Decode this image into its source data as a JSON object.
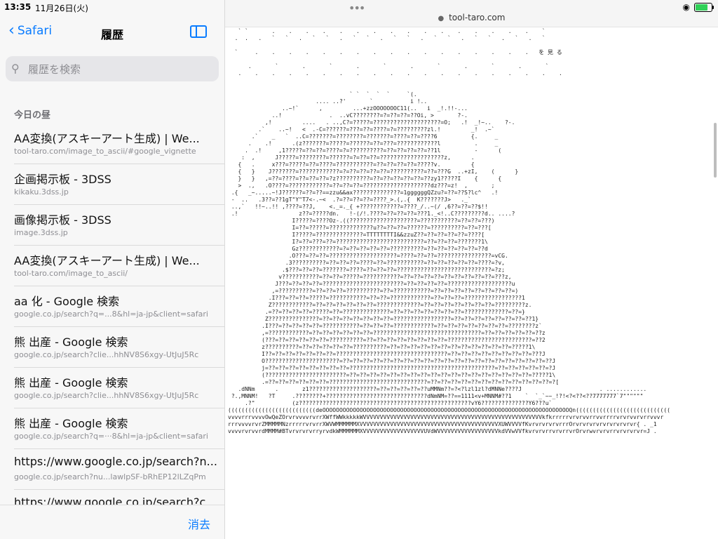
{
  "status": {
    "time": "13:35",
    "date": "11月26日(火)"
  },
  "sidebar": {
    "back_label": "Safari",
    "title": "履歴",
    "search_placeholder": "履歴を検索",
    "section": "今日の昼",
    "items": [
      {
        "title": "AA変換(アスキーアート生成) | We...",
        "url": "tool-taro.com/image_to_ascii/#google_vignette"
      },
      {
        "title": "企画掲示板 - 3DSS",
        "url": "kikaku.3dss.jp"
      },
      {
        "title": "画像掲示板 - 3DSS",
        "url": "image.3dss.jp"
      },
      {
        "title": "AA変換(アスキーアート生成) | We...",
        "url": "tool-taro.com/image_to_ascii/"
      },
      {
        "title": "aa 化 - Google 検索",
        "url": "google.co.jp/search?q=...8&hl=ja-jp&client=safari"
      },
      {
        "title": "熊 出産 - Google 検索",
        "url": "google.co.jp/search?clie...hhNV8S6xgy-UtJuJ5Rc"
      },
      {
        "title": "熊 出産 - Google 検索",
        "url": "google.co.jp/search?clie...hhNV8S6xgy-UtJuJ5Rc"
      },
      {
        "title": "熊 出産 - Google 検索",
        "url": "google.co.jp/search?q=···8&hl=ja-jp&client=safari"
      },
      {
        "title": "https://www.google.co.jp/search?n...",
        "url": "google.co.jp/search?nu...lawlpSF-bRhEP12lLZqPm"
      },
      {
        "title": "https://www.google.co.jp/search?cli...",
        "url": ""
      }
    ],
    "clear_label": "消去"
  },
  "browser": {
    "url": "tool-taro.com",
    "ascii_art": "   ` `       .    .    .    .    .    .    .    .    .    .    .    .    .    .    .    .    `  \n  .  .   .   `   `   .   `   `   .   `   `   .   `   `   .   `   `   .   `   `   .   `   .   `\n\n  `     .    .    .    .    .    .    .    .    .    .    .    .    .    .    .    .    .   を 見 る\n\n      .       `       .       `       .       `       .       `       .       `       .       `\n   .    .    .    .    .    .    .    .    .    .    .    .    .    .    .    .    .    .    .    .\n\n\n                                    ` `  `  `  `     `(.\n                          .... ..?'       `           i !..\n                ..~!`      ,         ...+zzOOOOOOOC11(..   i  _!.!!-...\n             ..!              .  ..vC????????=?=??=??=??Oi, >       ?-.\n           ,!         ....   . ..,C?=?????=????????????????????=O;   .!  _!~..    ?-.\n         .`    ..~!   <  .-C=??????=???=??=????=?=?????????zl.!         _!  .~`\n       .`    _   `  ..C=???????=????????=???????=????=??=????6          {.     _\n      .    .!      .(z???????=?????=??????=??=???=????????????l          .     _\n     .  .!     ,1?????=??=??=????=?=??????????=??=??=??=??=??1l          -      (\n    :  ,      J?????=????????=??????=?=??=??=???????????????????z,      .\n   {   .     x???=?????=??=????=???????????=??=??=??=??=?????v.         {\n   {   }    J???????=????????????=?=??=??=??=??=??????????=??=???G  ..+zI,    (      }\n   }   }   ,=??=????=??=??=??=?z??????????=??=??=??=??=??=??zy1?????I    {      {\n   >  .,   .O????=????????????=??=??=??=????????????????????dz???=z!  ,       ;\n .{   _~.....~!J??????=??=??==zzu&&ax??????????????=1ggggggQZzu?=??=??S?lc^   .!\n -  ..   .3??=??1gT\"Y\"T7<-.~<  .?=??=??=??=????_>.(,.{  K???????J>   ._`\n ..,`   !!~..!! ,????=??J,    <._=._{ +????????????=????_/..~(/ ,6??=??=??$!!\n .!                  z??=?????dn.   !-(/!.????=??=??=??=???1._<!..C?????????d.. ....?\n                   I?????=????Oz-.((????????????????????=???????????=??=??=???)\n                   I=??=?????=?????????????u??=??=??=??????=??????????=??=???[\n                   I?????=??????????????=TTTTTTTTI&&zzuZ??=??=??=??=??=????[\n                   I?=??=???=??=??????????????????????????=??=??=??=???????1\\\n                   Gz????????????=?=??=??=??=??=??????????=??=??=??=??=??=??d\n                  .O???=??=??=????????????????????=????=??=??=????????????????=vCG.\n                 .3??????????=??=??=??=????=??=???????????=??=??=??=??=??=????=?v,\n                .$???=??=??=???????=????=??=??=??=????????????????????????????=?z;\n               v???????????=??=??=?????=???????????=??=??=??=??=??=??=??=??=??=???z,\n              J???=??=??=??=????????????????????????=??=??=??=??=???????????????????u\n             ,=??????????=??=??=??=??????????=??=???????????=??=??=??=??=??=??=??=??=)\n            .I???=??=??=?????=???????????=??=??=????????????=??=??=??=?????????????????1\n            Z????????????=??=??=??=??=??=??=?????????????=??=??=??=??=??=??=??=?????????z.\n           .=??=??=??=??=?????=??=??????????????=??=??=??=??=??=??=??=?????????????=??=}\n           Z???????????????=??=??=??=??=??=??=??=?????????????????=??=??=??=??=??=??=??=??1}\n          .I???=??=??=??=??=???????????=??=??=??=????????????=??=??=??=??=??=??=??=????????z`\n          ,=????????????=??=??=??=??=??=??=????????????????????????????????=??=??=??=??=??=??z\n          (???=??=??=??=??=??=??????????=??=??=??=??=??=??=??=??=?????????????????????????=??2\n          z??????????=??=??=??=??=??=??????????=??=??=??=??=??=??=??=??=??=??=??=??=?????1\\\n          I??=??=??=??=??=??=??=?????????????????????????????????=??=??=??=??=??=??=??=??=???J\n          O??????????????????????=??=??=??=??=??=??=??=??=??=??=??=??=??=??=??=??=??=??=??=??=??J\n          j=??=??=??=??=??=??=??=??=???????????????????????????????????????????=??=??=??=??=??=?J\n          (????????????????????????=??=??=??=??=??=??=??=??=??=??=??=??=??=??=??=??=??=??=?????1\\\n          .=??=??=??=??=??=??=?????????????????????????????=??=??=??=??=??=??=??=??=??=??=??=??=?[\n   .dNNm      .       z1????????????????????=??=??=??=??=??uMMNm??=?<?lzl1zl?dMNNe????J                       . ............\n ?.,MNNM!   ?T     .????????+??????????????????????????????dNmNM=??==1111<v+MNNM#??1    `  `_`~~_!?!<?<??<??7777777`7\"\"\"\"\"\"\n     .?\"           (z???????????????????????????????????????????????????vY6??????????????Y6???u`\n((((((((((((((((((((((((((deOOOOOOOOOOOOOOOOOOOOOOOOOOOOOOOOOOOOOOOOOOOOOOOOOOOOOOOOOOOOOOOOOOOOOOOOOQn((((((((((((((((((((((((((((\nvvvvrrrvvvvOwQeZOrvrvvvvrvrrXWffWWkkkkkWVVVVVVVVVVVVVVVVVVVVVVVVVVVVVVVVVVVVVVVVVVVVVVVVVVVVVkfkrrrrrvrvrvvrrvvrrrrvrvrvvrvrrvvvr\nrrrvvvvrvrZMMMMMNzrrrrrvrvrrXWVWMMMMMMXVVVVVVVVVVVVVVVVVVVVVVVVVVVVVVVVVVVVVVVVVXUWVVVVfKvrvrvrvrvrrrOrvrvrvrvrvrvrvrvrvr{ . _1\nvvvvrvrvvrdMMMM#BTvrvrvrvrryrvdkWMMMMMMXVVVVVVVVVVVVVVVVVVUVdWVVVVVVVVVVVVVVVVVVkdVVwVVfkvrvrvrrvrvrrvrOrvrwvrvrvrrvrvrvrvr=J ."
  }
}
